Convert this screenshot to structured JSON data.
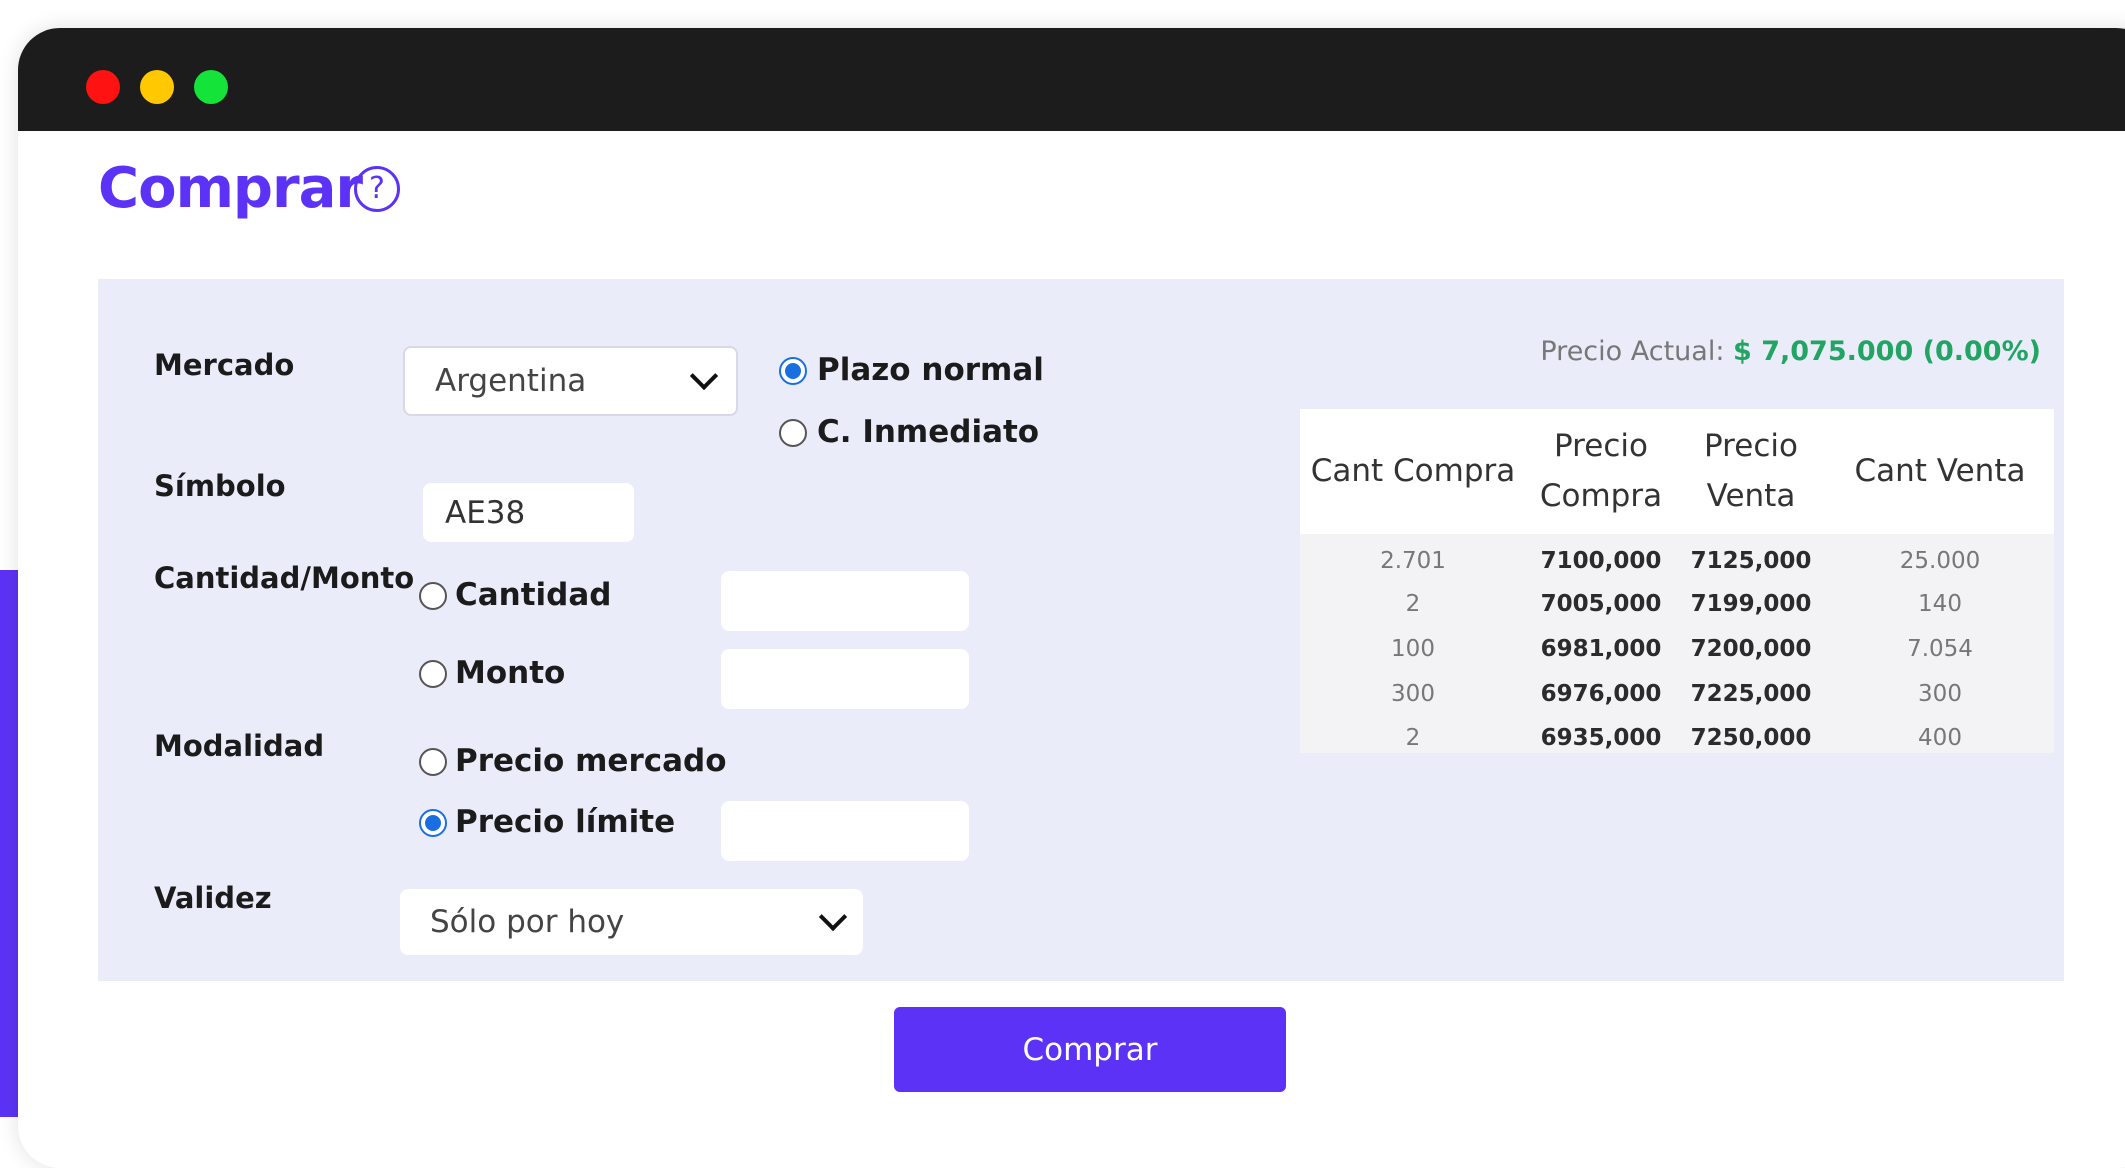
{
  "page": {
    "title": "Comprar",
    "help_icon": "?",
    "accent": "#5c33f6"
  },
  "window": {
    "controls": [
      "close",
      "minimize",
      "maximize"
    ],
    "colors": {
      "close": "#ff1212",
      "minimize": "#ffc800",
      "maximize": "#14e33a"
    }
  },
  "form": {
    "mercado_label": "Mercado",
    "mercado_value": "Argentina",
    "plazo_options": [
      {
        "label": "Plazo normal",
        "checked": true
      },
      {
        "label": "C. Inmediato",
        "checked": false
      }
    ],
    "simbolo_label": "Símbolo",
    "simbolo_value": "AE38",
    "cantidad_monto_label": "Cantidad/Monto",
    "cantidad_label": "Cantidad",
    "cantidad_value": "",
    "monto_label": "Monto",
    "monto_value": "",
    "modalidad_label": "Modalidad",
    "precio_mercado_label": "Precio mercado",
    "precio_limite_label": "Precio límite",
    "precio_limite_value": "",
    "validez_label": "Validez",
    "validez_value": "Sólo por hoy"
  },
  "quote": {
    "label": "Precio Actual:",
    "value": "$ 7,075.000 (0.00%)",
    "color": "#22a463"
  },
  "order_book": {
    "headers": [
      "Cant Compra",
      "Precio Compra",
      "Precio Venta",
      "Cant Venta"
    ],
    "header_lines": [
      [
        "Cant Compra"
      ],
      [
        "Precio",
        "Compra"
      ],
      [
        "Precio",
        "Venta"
      ],
      [
        "Cant Venta"
      ]
    ],
    "rows": [
      [
        "2.701",
        "7100,000",
        "7125,000",
        "25.000"
      ],
      [
        "2",
        "7005,000",
        "7199,000",
        "140"
      ],
      [
        "100",
        "6981,000",
        "7200,000",
        "7.054"
      ],
      [
        "300",
        "6976,000",
        "7225,000",
        "300"
      ],
      [
        "2",
        "6935,000",
        "7250,000",
        "400"
      ]
    ]
  },
  "actions": {
    "buy_label": "Comprar"
  }
}
